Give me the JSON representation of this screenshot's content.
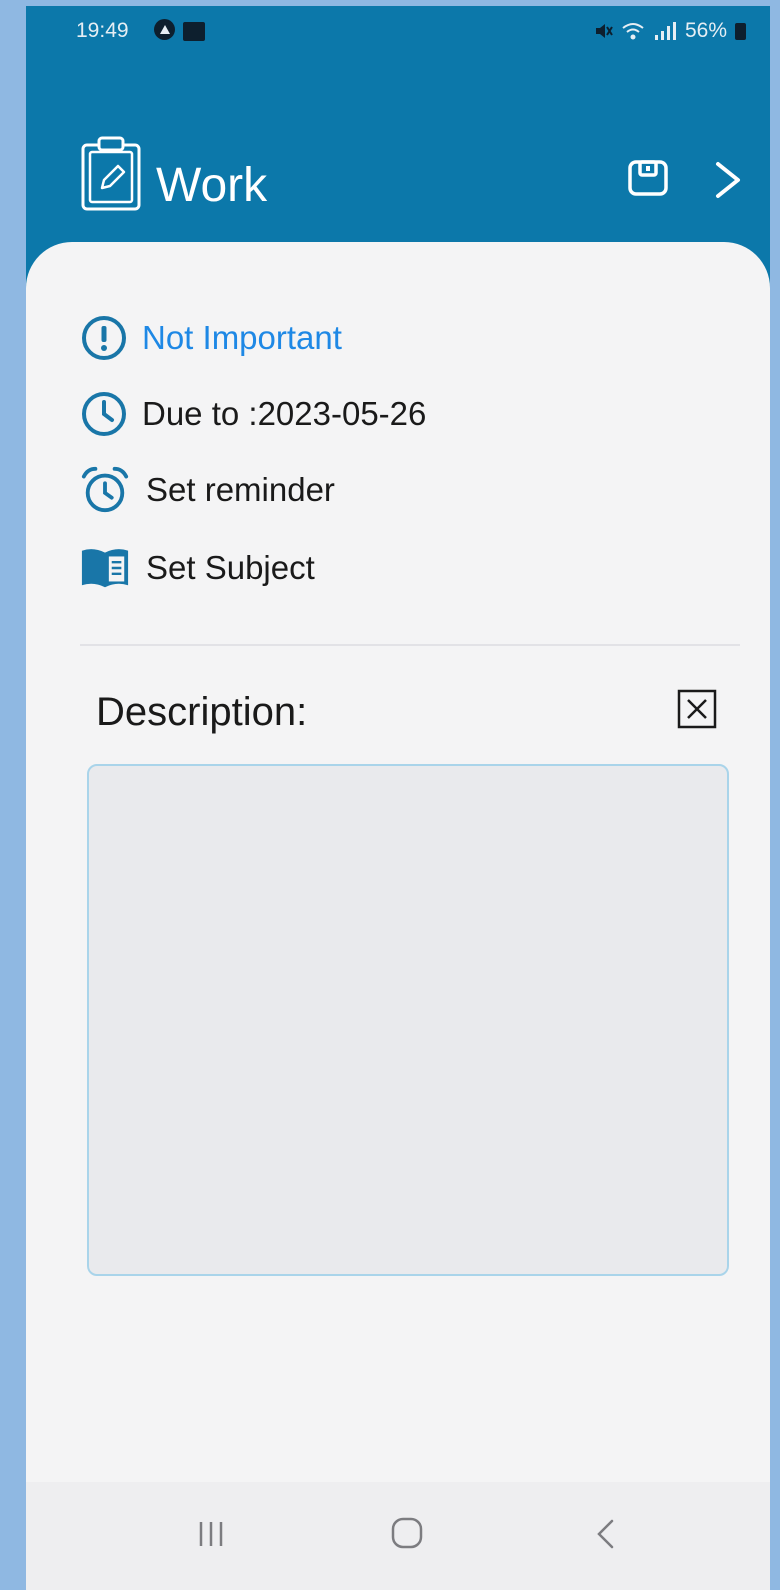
{
  "status_bar": {
    "time": "19:49",
    "battery": "56%"
  },
  "header": {
    "title": "Work",
    "background": "#0c78aa",
    "icons": [
      "clipboard-icon",
      "save-icon",
      "chevron-right-icon"
    ]
  },
  "details": {
    "importance": "Not Important",
    "due": "Due to :2023-05-26",
    "reminder": "Set reminder",
    "subject": "Set Subject"
  },
  "description": {
    "label": "Description:",
    "value": ""
  },
  "colors": {
    "accent": "#1e88e5",
    "icon": "#1976a8"
  }
}
